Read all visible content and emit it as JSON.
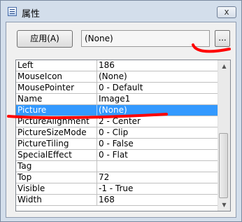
{
  "window": {
    "title": "属性",
    "close_label": "x"
  },
  "toolbar": {
    "apply_label": "应用(A)",
    "value_text": "(None)",
    "ellipsis_label": "..."
  },
  "properties": [
    {
      "name": "Left",
      "value": "186"
    },
    {
      "name": "MouseIcon",
      "value": "(None)"
    },
    {
      "name": "MousePointer",
      "value": "0 - Default"
    },
    {
      "name": "Name",
      "value": "Image1"
    },
    {
      "name": "Picture",
      "value": "(None)",
      "selected": true
    },
    {
      "name": "PictureAlignment",
      "value": "2 - Center"
    },
    {
      "name": "PictureSizeMode",
      "value": "0 - Clip"
    },
    {
      "name": "PictureTiling",
      "value": "0 - False"
    },
    {
      "name": "SpecialEffect",
      "value": "0 - Flat"
    },
    {
      "name": "Tag",
      "value": ""
    },
    {
      "name": "Top",
      "value": "72"
    },
    {
      "name": "Visible",
      "value": "-1 - True"
    },
    {
      "name": "Width",
      "value": "168"
    }
  ],
  "colors": {
    "selection": "#3399ff",
    "annotation": "#ff0000"
  }
}
